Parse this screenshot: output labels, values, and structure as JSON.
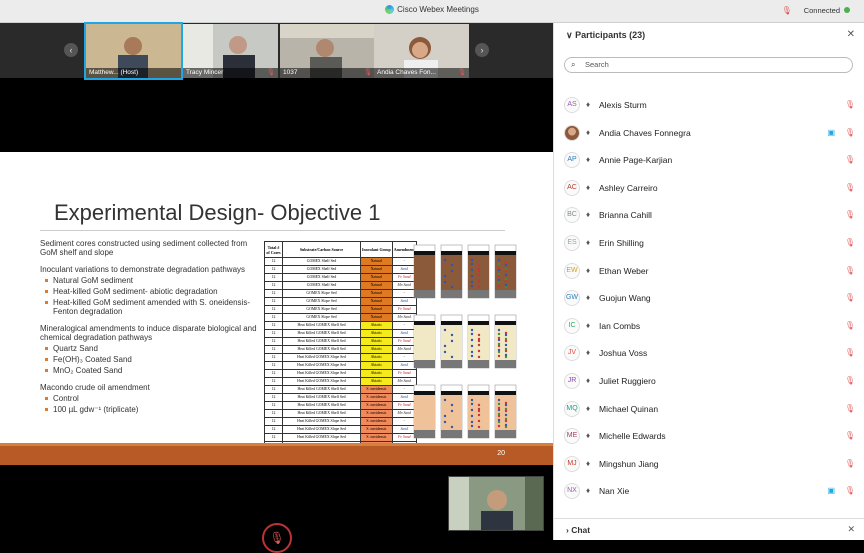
{
  "app_title": "Cisco Webex Meetings",
  "connection": "Connected",
  "video_strip": [
    {
      "name": "Matthew...",
      "tag": "(Host)"
    },
    {
      "name": "Tracy Mincer",
      "tag": ""
    },
    {
      "name": "1037",
      "tag": ""
    },
    {
      "name": "Andia Chaves Fon...",
      "tag": ""
    }
  ],
  "slide": {
    "title": "Experimental Design- Objective 1",
    "page": "20",
    "bullets": [
      {
        "text": "Sediment cores constructed using sediment collected from GoM shelf and slope",
        "sub": []
      },
      {
        "text": "Inoculant variations to demonstrate degradation pathways",
        "sub": [
          "Natural GoM sediment",
          "Heat-killed GoM sediment- abiotic degradation",
          "Heat-killed GoM sediment amended with S. oneidensis- Fenton degradation"
        ]
      },
      {
        "text": "Mineralogical amendments to induce disparate biological and chemical degradation pathways",
        "sub": [
          "Quartz Sand",
          "Fe(OH)₃ Coated Sand",
          "MnO₂ Coated Sand"
        ]
      },
      {
        "text": "Macondo crude oil amendment",
        "sub": [
          "Control",
          "100 µL gdw⁻¹ (triplicate)"
        ]
      }
    ],
    "table": {
      "headers": [
        "Total # of Cores",
        "Substrate/Carbon Source",
        "Inoculant Group",
        "Amendment"
      ],
      "rows": [
        [
          "12",
          "GOMEX Shelf Sed",
          "Natural",
          "-"
        ],
        [
          "12",
          "GOMEX Shelf Sed",
          "Natural",
          "Sand"
        ],
        [
          "12",
          "GOMEX Shelf Sed",
          "Natural",
          "Fe Sand"
        ],
        [
          "12",
          "GOMEX Shelf Sed",
          "Natural",
          "Mn Sand"
        ],
        [
          "12",
          "GOMEX Slope Sed",
          "Natural",
          "-"
        ],
        [
          "12",
          "GOMEX Slope Sed",
          "Natural",
          "Sand"
        ],
        [
          "12",
          "GOMEX Slope Sed",
          "Natural",
          "Fe Sand"
        ],
        [
          "12",
          "GOMEX Slope Sed",
          "Natural",
          "Mn Sand"
        ],
        [
          "12",
          "Heat Killed GOMEX Shelf Sed",
          "Abiotic",
          "-"
        ],
        [
          "12",
          "Heat Killed GOMEX Shelf Sed",
          "Abiotic",
          "Sand"
        ],
        [
          "12",
          "Heat Killed GOMEX Shelf Sed",
          "Abiotic",
          "Fe Sand"
        ],
        [
          "12",
          "Heat Killed GOMEX Shelf Sed",
          "Abiotic",
          "Mn Sand"
        ],
        [
          "12",
          "Heat Killed GOMEX Slope Sed",
          "Abiotic",
          "-"
        ],
        [
          "12",
          "Heat Killed GOMEX Slope Sed",
          "Abiotic",
          "Sand"
        ],
        [
          "12",
          "Heat Killed GOMEX Slope Sed",
          "Abiotic",
          "Fe Sand"
        ],
        [
          "12",
          "Heat Killed GOMEX Slope Sed",
          "Abiotic",
          "Mn Sand"
        ],
        [
          "12",
          "Heat Killed GOMEX Shelf Sed",
          "S. oneidensis",
          "-"
        ],
        [
          "12",
          "Heat Killed GOMEX Shelf Sed",
          "S. oneidensis",
          "Sand"
        ],
        [
          "12",
          "Heat Killed GOMEX Shelf Sed",
          "S. oneidensis",
          "Fe Sand"
        ],
        [
          "12",
          "Heat Killed GOMEX Shelf Sed",
          "S. oneidensis",
          "Mn Sand"
        ],
        [
          "12",
          "Heat Killed GOMEX Slope Sed",
          "S. oneidensis",
          "-"
        ],
        [
          "12",
          "Heat Killed GOMEX Slope Sed",
          "S. oneidensis",
          "Sand"
        ],
        [
          "12",
          "Heat Killed GOMEX Slope Sed",
          "S. oneidensis",
          "Fe Sand"
        ],
        [
          "12",
          "Heat Killed GOMEX Slope Sed",
          "S. oneidensis",
          "Mn Sand"
        ]
      ]
    }
  },
  "panel": {
    "title": "Participants (23)",
    "search_placeholder": "Search",
    "participants": [
      {
        "initials": "AS",
        "name": "Alexis Sturm",
        "video": false
      },
      {
        "initials": "",
        "name": "Andia Chaves Fonnegra",
        "video": true
      },
      {
        "initials": "AP",
        "name": "Annie Page-Karjian",
        "video": false
      },
      {
        "initials": "AC",
        "name": "Ashley Carreiro",
        "video": false
      },
      {
        "initials": "BC",
        "name": "Brianna Cahill",
        "video": false
      },
      {
        "initials": "ES",
        "name": "Erin Shilling",
        "video": false
      },
      {
        "initials": "EW",
        "name": "Ethan Weber",
        "video": false
      },
      {
        "initials": "GW",
        "name": "Guojun Wang",
        "video": false
      },
      {
        "initials": "IC",
        "name": "Ian Combs",
        "video": false
      },
      {
        "initials": "JV",
        "name": "Joshua Voss",
        "video": false
      },
      {
        "initials": "JR",
        "name": "Juliet Ruggiero",
        "video": false
      },
      {
        "initials": "MQ",
        "name": "Michael Quinan",
        "video": false
      },
      {
        "initials": "ME",
        "name": "Michelle Edwards",
        "video": false
      },
      {
        "initials": "MJ",
        "name": "Mingshun Jiang",
        "video": false
      },
      {
        "initials": "NX",
        "name": "Nan Xie",
        "video": true
      }
    ],
    "chat_title": "Chat"
  },
  "colors": {
    "accent": "#1ea7e4",
    "muted_mic": "#e25a5a",
    "slide_footer": "#b85a26",
    "natural": "#e07a22",
    "abiotic": "#f4ea1c",
    "oneidensis": "#f08a5a"
  },
  "icons": {
    "muted": "microphone-muted-icon",
    "video": "video-camera-icon",
    "close": "close-icon",
    "search": "search-icon"
  }
}
